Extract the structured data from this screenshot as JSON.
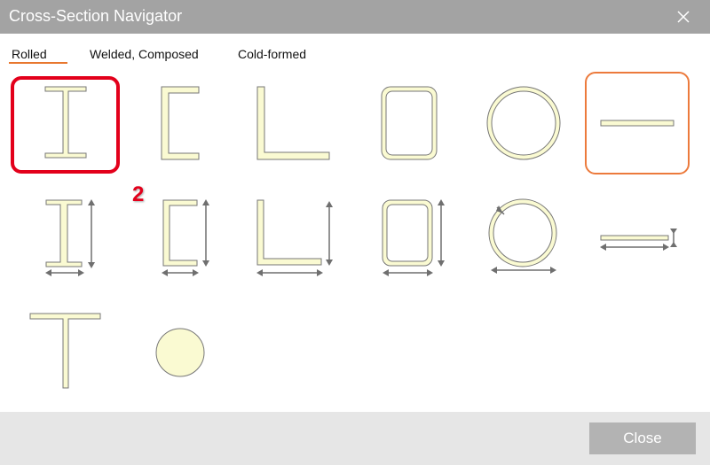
{
  "window": {
    "title": "Cross-Section Navigator"
  },
  "tabs": [
    {
      "label": "Rolled",
      "active": true
    },
    {
      "label": "Welded, Composed",
      "active": false
    },
    {
      "label": "Cold-formed",
      "active": false
    }
  ],
  "sections": {
    "row1": [
      "i-section-icon",
      "channel-section-icon",
      "angle-section-icon",
      "rectangular-hollow-icon",
      "circular-hollow-icon",
      "flat-bar-icon"
    ],
    "row2": [
      "i-section-dimensions-icon",
      "channel-dimensions-icon",
      "angle-dimensions-icon",
      "rectangular-hollow-dimensions-icon",
      "circular-hollow-dimensions-icon",
      "flat-bar-dimensions-icon"
    ],
    "row3": [
      "t-section-icon",
      "round-bar-icon"
    ]
  },
  "annotation": {
    "step_number": "2"
  },
  "footer": {
    "close_label": "Close"
  },
  "colors": {
    "titlebar": "#a3a3a3",
    "accent": "#e8772e",
    "selection_red": "#e3001b",
    "section_fill": "#fafad2"
  }
}
